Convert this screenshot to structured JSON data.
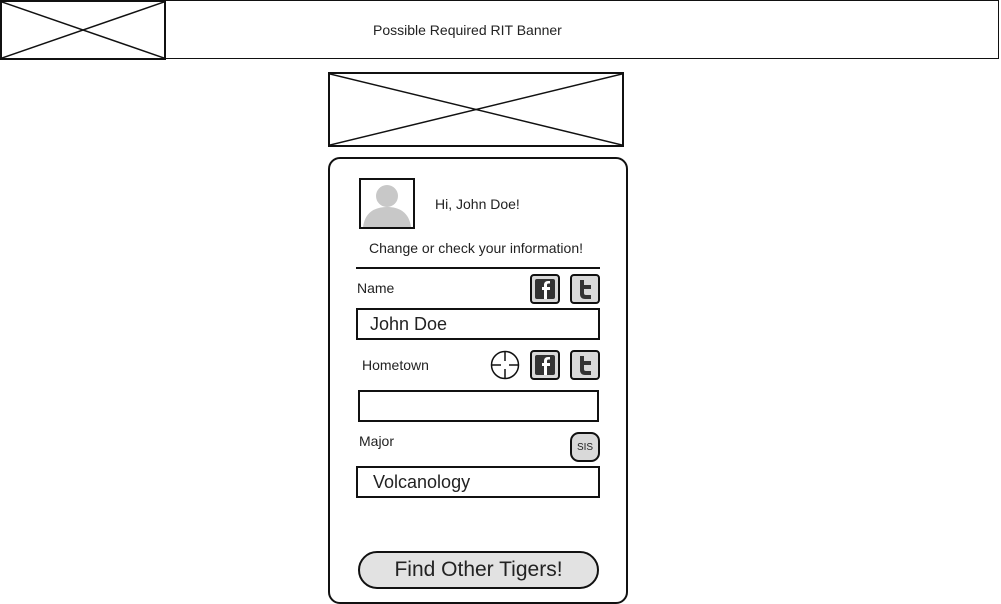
{
  "banner": {
    "text": "Possible Required RIT Banner"
  },
  "profile": {
    "greeting": "Hi, John Doe!",
    "subtitle": "Change or check your information!"
  },
  "fields": {
    "name": {
      "label": "Name",
      "value": "John Doe"
    },
    "hometown": {
      "label": "Hometown",
      "value": ""
    },
    "major": {
      "label": "Major",
      "value": "Volcanology"
    }
  },
  "buttons": {
    "sis_label": "SIS",
    "find_label": "Find Other Tigers!"
  },
  "icons": {
    "facebook": "facebook-icon",
    "twitter": "twitter-icon",
    "location": "crosshair-location-icon",
    "placeholder": "image-placeholder-icon",
    "avatar": "user-avatar-icon"
  }
}
